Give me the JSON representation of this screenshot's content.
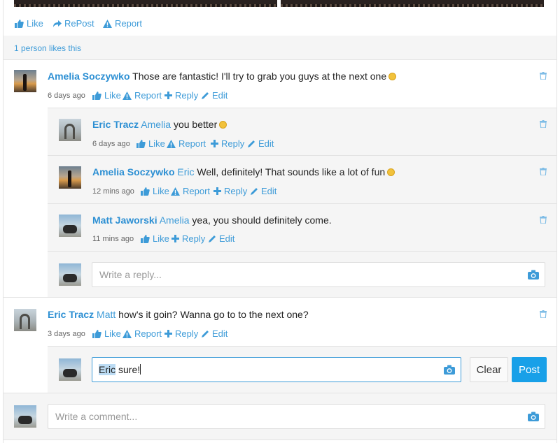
{
  "post_actions": {
    "like": "Like",
    "repost": "RePost",
    "report": "Report"
  },
  "likes_summary": "1 person likes this",
  "comment_actions": {
    "like": "Like",
    "report": "Report",
    "reply": "Reply",
    "edit": "Edit"
  },
  "comments": [
    {
      "author": "Amelia Soczywko",
      "text": "Those are fantastic! I'll try to grab you guys at the next one",
      "time": "6 days ago",
      "replies": [
        {
          "author": "Eric Tracz",
          "mention": "Amelia",
          "text": "you better",
          "time": "6 days ago"
        },
        {
          "author": "Amelia Soczywko",
          "mention": "Eric",
          "text": "Well, definitely! That sounds like a lot of fun",
          "time": "12 mins ago"
        },
        {
          "author": "Matt Jaworski",
          "mention": "Amelia",
          "text": "yea, you should definitely come.",
          "time": "11 mins ago"
        }
      ],
      "reply_placeholder": "Write a reply..."
    },
    {
      "author": "Eric Tracz",
      "mention": "Matt",
      "text": "how's it goin? Wanna go to to the next one?",
      "time": "3 days ago",
      "reply_draft": {
        "mention": "Eric",
        "text": "sure!"
      },
      "clear_label": "Clear",
      "post_label": "Post"
    }
  ],
  "comment_placeholder": "Write a comment...",
  "icons": [
    "thumbs-up-icon",
    "repost-icon",
    "warning-icon",
    "plus-icon",
    "pencil-icon",
    "trash-icon",
    "camera-icon",
    "emoji-icon"
  ],
  "colors": {
    "accent": "#3d9bd8",
    "post_button": "#18a0e8",
    "band": "#f5f5f5"
  }
}
